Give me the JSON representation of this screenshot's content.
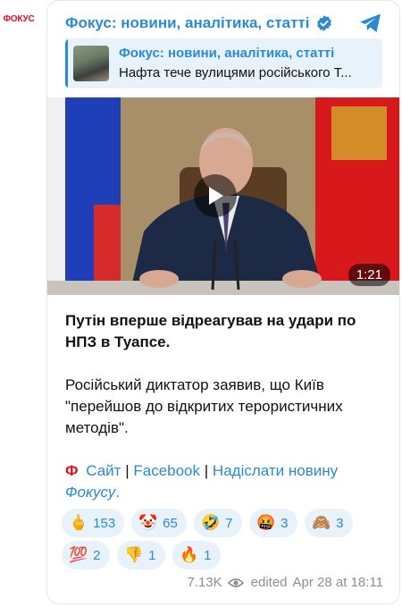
{
  "avatar": {
    "text": "ФОКУС"
  },
  "header": {
    "channel_name": "Фокус: новини, аналітика, статті"
  },
  "reply": {
    "title": "Фокус: новини, аналітика, статті",
    "text": "Нафта тече вулицями російського Т..."
  },
  "video": {
    "duration": "1:21"
  },
  "post": {
    "headline_line1": "Путін вперше відреагував на удари по",
    "headline_line2": "НПЗ в Туапсе.",
    "body_line1": "Російський диктатор заявив, що Київ",
    "body_line2": "\"перейшов до відкритих терористичних",
    "body_line3": "методів\".",
    "logo_letter": "Ф",
    "link_site": "Сайт",
    "separator": "|",
    "link_facebook": "Facebook",
    "link_send": "Надіслати новину",
    "link_fokusu": "Фокусу",
    "trailing_dot": "."
  },
  "reactions": [
    {
      "emoji": "🖕",
      "count": "153"
    },
    {
      "emoji": "🤡",
      "count": "65"
    },
    {
      "emoji": "🤣",
      "count": "7"
    },
    {
      "emoji": "🤬",
      "count": "3"
    },
    {
      "emoji": "🙈",
      "count": "3"
    },
    {
      "emoji": "💯",
      "count": "2"
    },
    {
      "emoji": "👎",
      "count": "1"
    },
    {
      "emoji": "🔥",
      "count": "1"
    }
  ],
  "meta": {
    "views": "7.13K",
    "edited": "edited",
    "date": "Apr 28 at 18:11"
  },
  "colors": {
    "accent": "#2b8ad6",
    "brand_red": "#d7141e",
    "reaction_bg": "#e8f2fb"
  }
}
